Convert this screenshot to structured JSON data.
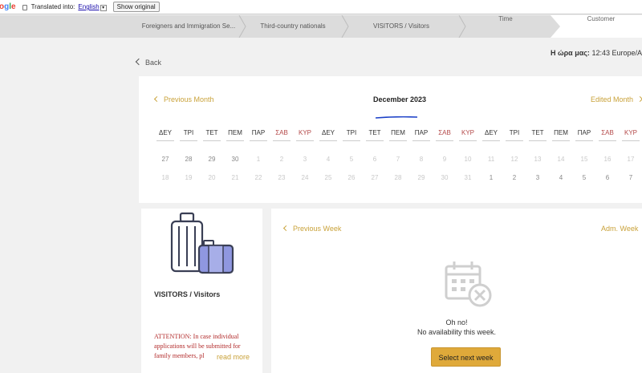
{
  "translate_bar": {
    "logo": "ogle",
    "translated_into": "Translated into:",
    "language": "English",
    "show_original": "Show original"
  },
  "steps": [
    {
      "ghost": "",
      "label": "Foreigners and Immigration Se..."
    },
    {
      "ghost": "",
      "label": "Third-country nationals"
    },
    {
      "ghost": "",
      "label": "VISITORS / Visitors"
    },
    {
      "ghost": "",
      "label": "Time"
    }
  ],
  "active_step": {
    "label": "Customer"
  },
  "back_label": "Back",
  "clock": {
    "label": "Η ώρα μας:",
    "value": "12:43 Europe/A"
  },
  "calendar": {
    "prev_label": "Previous Month",
    "next_label": "Edited Month",
    "month_title": "December 2023",
    "weekday_headers": [
      "ΔΕΥ",
      "ΤΡΙ",
      "ΤΕΤ",
      "ΠΕΜ",
      "ΠΑΡ",
      "ΣΑΒ",
      "ΚΥΡ",
      "ΔΕΥ",
      "ΤΡΙ",
      "ΤΕΤ",
      "ΠΕΜ",
      "ΠΑΡ",
      "ΣΑΒ",
      "ΚΥΡ",
      "ΔΕΥ",
      "ΤΡΙ",
      "ΤΕΤ",
      "ΠΕΜ",
      "ΠΑΡ",
      "ΣΑΒ",
      "ΚΥΡ"
    ],
    "row1": [
      "27",
      "28",
      "29",
      "30",
      "1",
      "2",
      "3",
      "4",
      "5",
      "6",
      "7",
      "8",
      "9",
      "10",
      "11",
      "12",
      "13",
      "14",
      "15",
      "16",
      "17"
    ],
    "row2": [
      "18",
      "19",
      "20",
      "21",
      "22",
      "23",
      "24",
      "25",
      "26",
      "27",
      "28",
      "29",
      "30",
      "31",
      "1",
      "2",
      "3",
      "4",
      "5",
      "6",
      "7"
    ],
    "colors": {
      "weekend": "#b44a4a",
      "accent": "#c9a23a",
      "underline": "#1a3fc7"
    }
  },
  "service": {
    "title": "VISITORS / Visitors",
    "note": "ATTENTION: In case individual applications will be submitted for family members, pl",
    "read_more": "read more",
    "icon": "luggage-icon"
  },
  "week": {
    "prev_label": "Previous Week",
    "next_label": "Adm. Week",
    "oh_no": "Oh no!",
    "no_availability": "No availability this week.",
    "button": "Select next week",
    "icon": "calendar-unavailable-icon"
  }
}
